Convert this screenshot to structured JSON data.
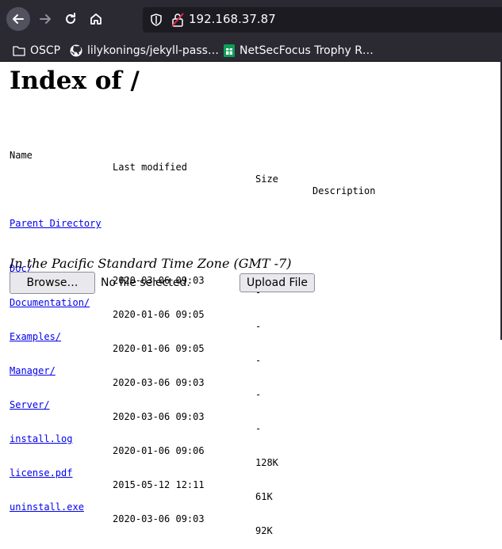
{
  "browser": {
    "url": "192.168.37.87",
    "bookmarks": [
      {
        "label": "OSCP",
        "icon": "folder-icon"
      },
      {
        "label": "lilykonings/jekyll-pass…",
        "icon": "github-icon"
      },
      {
        "label": "NetSecFocus Trophy R…",
        "icon": "sheets-icon"
      }
    ]
  },
  "page": {
    "title": "Index of /",
    "headers": {
      "name": "Name",
      "modified": "Last modified",
      "size": "Size",
      "description": "Description"
    },
    "parent": "Parent Directory",
    "rows": [
      {
        "name": "Doc/",
        "modified": "2020-03-06 09:03",
        "size": "-"
      },
      {
        "name": "Documentation/",
        "modified": "2020-01-06 09:05",
        "size": "-"
      },
      {
        "name": "Examples/",
        "modified": "2020-01-06 09:05",
        "size": "-"
      },
      {
        "name": "Manager/",
        "modified": "2020-03-06 09:03",
        "size": "-"
      },
      {
        "name": "Server/",
        "modified": "2020-03-06 09:03",
        "size": "-"
      },
      {
        "name": "install.log",
        "modified": "2020-01-06 09:06",
        "size": "128K"
      },
      {
        "name": "license.pdf",
        "modified": "2015-05-12 12:11",
        "size": "61K"
      },
      {
        "name": "uninstall.exe",
        "modified": "2020-03-06 09:03",
        "size": "92K"
      }
    ],
    "timezone": "In the Pacific Standard Time Zone (GMT -7)",
    "browse_label": "Browse…",
    "no_file": "No file selected.",
    "upload_label": "Upload File"
  },
  "colors": {
    "chrome": "#2b2a33",
    "link": "#0000ee"
  }
}
